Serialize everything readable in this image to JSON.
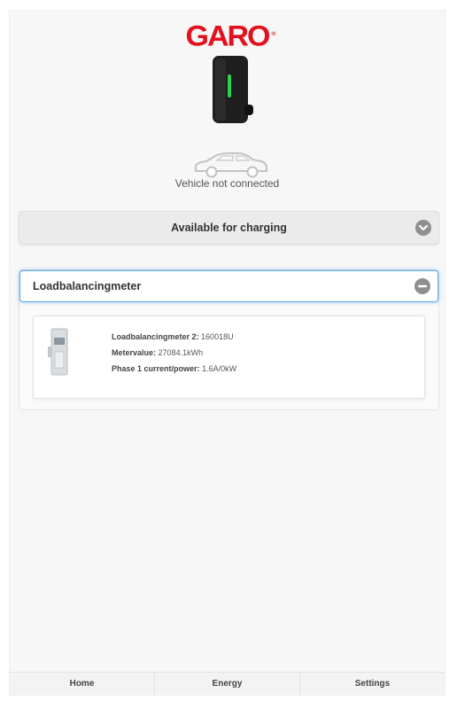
{
  "brand": {
    "logo_text": "GARO",
    "reg_mark": "®",
    "color": "#e3101d"
  },
  "charger": {
    "icon": "wallbox-charger-icon",
    "led_color": "#2bd24a"
  },
  "vehicle": {
    "icon": "car-icon",
    "status": "Vehicle not connected"
  },
  "charging_status": {
    "label": "Available for charging",
    "icon": "chevron-down-circle-icon"
  },
  "loadbalancing": {
    "title": "Loadbalancingmeter",
    "icon": "minus-circle-icon",
    "meter": {
      "icon": "din-rail-meter-icon",
      "rows": [
        {
          "key": "Loadbalancingmeter 2:",
          "value": "160018U"
        },
        {
          "key": "Metervalue:",
          "value": "27084.1kWh"
        },
        {
          "key": "Phase 1 current/power:",
          "value": "1.6A/0kW"
        }
      ]
    }
  },
  "tabs": [
    {
      "label": "Home"
    },
    {
      "label": "Energy"
    },
    {
      "label": "Settings"
    }
  ],
  "colors": {
    "focus_border": "#62a8e8",
    "panel_bg": "#f7f7f7"
  }
}
